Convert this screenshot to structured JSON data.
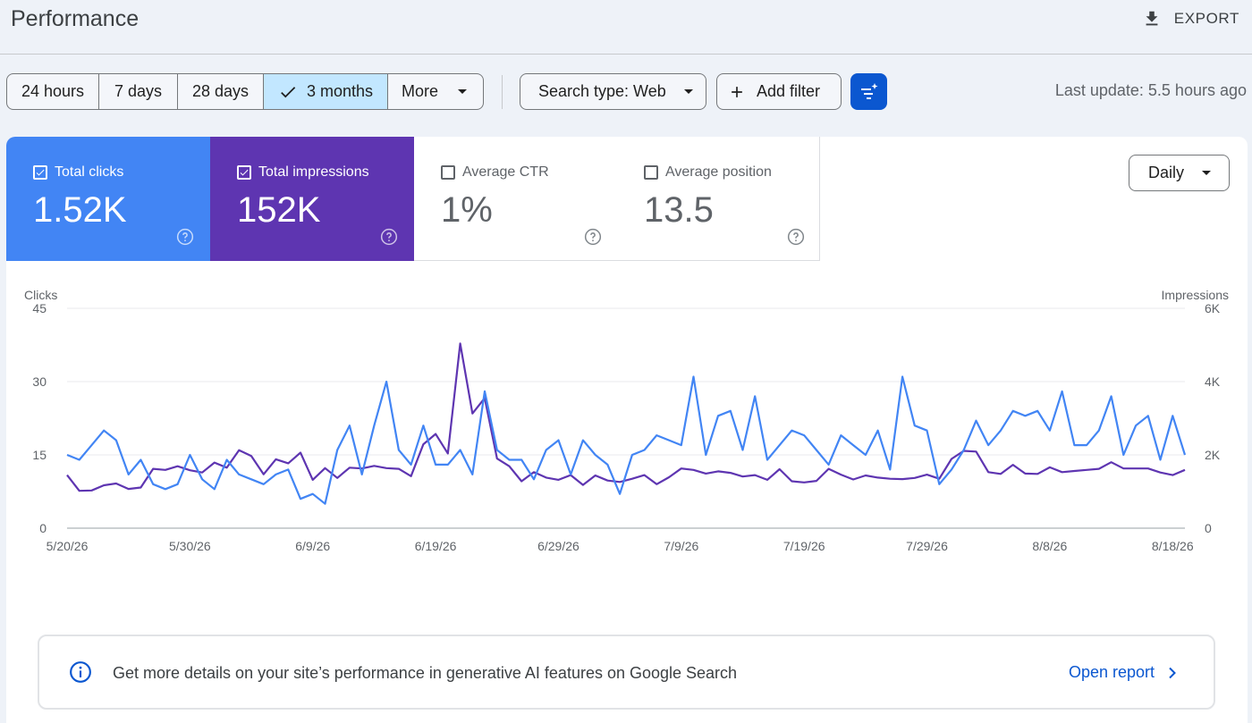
{
  "header": {
    "title": "Performance",
    "export_label": "EXPORT"
  },
  "toolbar": {
    "date_ranges": [
      "24 hours",
      "7 days",
      "28 days",
      "3 months"
    ],
    "more_label": "More",
    "selected_range": "3 months",
    "search_type_label": "Search type: Web",
    "add_filter_label": "Add filter",
    "last_update": "Last update: 5.5 hours ago"
  },
  "metrics": {
    "clicks": {
      "label": "Total clicks",
      "value": "1.52K",
      "checked": true,
      "color": "#4285f4"
    },
    "impressions": {
      "label": "Total impressions",
      "value": "152K",
      "checked": true,
      "color": "#5e35b1"
    },
    "ctr": {
      "label": "Average CTR",
      "value": "1%",
      "checked": false
    },
    "position": {
      "label": "Average position",
      "value": "13.5",
      "checked": false
    }
  },
  "granularity": {
    "selected": "Daily"
  },
  "banner": {
    "text": "Get more details on your site’s performance in generative AI features on Google Search",
    "link_label": "Open report"
  },
  "chart_data": {
    "type": "line",
    "ylabel_left": "Clicks",
    "ylabel_right": "Impressions",
    "ylim_left": [
      0,
      45
    ],
    "ylim_right": [
      0,
      6000
    ],
    "yticks_left": [
      "0",
      "15",
      "30",
      "45"
    ],
    "yticks_right": [
      "0",
      "2K",
      "4K",
      "6K"
    ],
    "x_tick_labels": [
      "5/20/26",
      "5/30/26",
      "6/9/26",
      "6/19/26",
      "6/29/26",
      "7/9/26",
      "7/19/26",
      "7/29/26",
      "8/8/26",
      "8/18/26"
    ],
    "x_start": "5/20/26",
    "x_end": "8/20/26",
    "grid": true,
    "series": [
      {
        "name": "Clicks",
        "axis": "left",
        "color": "#4285f4",
        "values": [
          15,
          14,
          17,
          20,
          18,
          11,
          14,
          9,
          8,
          9,
          15,
          10,
          8,
          14,
          11,
          10,
          9,
          11,
          12,
          6,
          7,
          5,
          16,
          21,
          11,
          21,
          30,
          16,
          13,
          21,
          13,
          13,
          16,
          11,
          28,
          16,
          14,
          14,
          10,
          16,
          18,
          11,
          18,
          15,
          13,
          7,
          15,
          16,
          19,
          18,
          17,
          31,
          15,
          23,
          24,
          16,
          27,
          14,
          17,
          20,
          19,
          16,
          13,
          19,
          17,
          15,
          20,
          12,
          31,
          21,
          20,
          9,
          12,
          16,
          22,
          17,
          20,
          24,
          23,
          24,
          20,
          28,
          17,
          17,
          20,
          27,
          15,
          21,
          23,
          14,
          23,
          15
        ]
      },
      {
        "name": "Impressions",
        "axis": "right",
        "color": "#5e35b1",
        "values": [
          1450,
          1020,
          1030,
          1170,
          1220,
          1070,
          1110,
          1620,
          1590,
          1690,
          1580,
          1520,
          1790,
          1650,
          2130,
          1970,
          1470,
          1880,
          1770,
          2060,
          1320,
          1640,
          1370,
          1650,
          1630,
          1700,
          1640,
          1620,
          1420,
          2290,
          2570,
          2040,
          5040,
          3130,
          3550,
          1900,
          1690,
          1280,
          1530,
          1380,
          1320,
          1450,
          1180,
          1440,
          1300,
          1260,
          1350,
          1450,
          1200,
          1390,
          1630,
          1590,
          1490,
          1550,
          1510,
          1410,
          1450,
          1320,
          1610,
          1280,
          1250,
          1290,
          1620,
          1460,
          1330,
          1440,
          1380,
          1350,
          1340,
          1370,
          1460,
          1350,
          1890,
          2110,
          2090,
          1530,
          1480,
          1730,
          1490,
          1480,
          1660,
          1530,
          1560,
          1590,
          1620,
          1800,
          1630,
          1630,
          1630,
          1520,
          1450,
          1590
        ]
      }
    ]
  }
}
